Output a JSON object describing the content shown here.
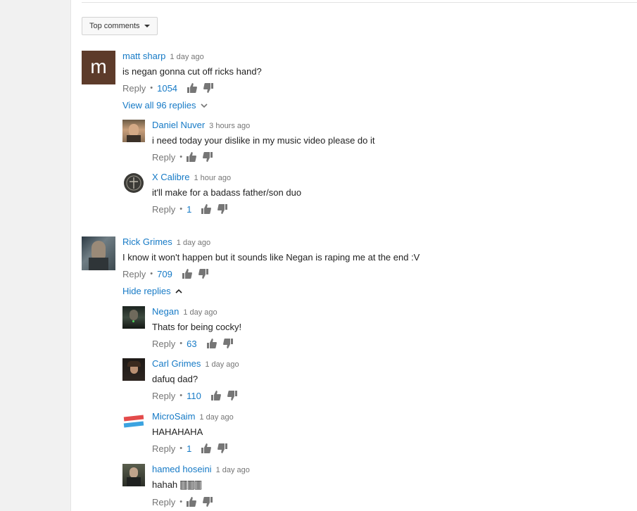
{
  "sort": {
    "label": "Top comments"
  },
  "threads": [
    {
      "author": "matt sharp",
      "time": "1 day ago",
      "text": "is negan gonna cut off ricks hand?",
      "reply_label": "Reply",
      "likes": "1054",
      "avatar_letter": "m",
      "toggle_label": "View all 96 replies",
      "replies": [
        {
          "author": "Daniel Nuver",
          "time": "3 hours ago",
          "text": "i need today your dislike in my music video please do it",
          "reply_label": "Reply",
          "likes": ""
        },
        {
          "author": "X Calibre",
          "time": "1 hour ago",
          "text": "it'll make for a badass father/son duo",
          "reply_label": "Reply",
          "likes": "1"
        }
      ]
    },
    {
      "author": "Rick Grimes",
      "time": "1 day ago",
      "text": "I know it won't happen but it sounds like Negan is raping me at the end :V",
      "reply_label": "Reply",
      "likes": "709",
      "toggle_label": "Hide replies",
      "replies": [
        {
          "author": "Negan",
          "time": "1 day ago",
          "text": "Thats for being cocky!",
          "reply_label": "Reply",
          "likes": "63"
        },
        {
          "author": "Carl Grimes",
          "time": "1 day ago",
          "text": "dafuq dad?",
          "reply_label": "Reply",
          "likes": "110"
        },
        {
          "author": "MicroSaim",
          "time": "1 day ago",
          "text": "HAHAHAHA",
          "reply_label": "Reply",
          "likes": "1"
        },
        {
          "author": "hamed hoseini",
          "time": "1 day ago",
          "text": "hahah 🀫🀫🀫",
          "reply_label": "Reply",
          "likes": ""
        }
      ]
    }
  ],
  "colors": {
    "link": "#167ac6",
    "meta": "#767676",
    "avatar_m_bg": "#5d3b2a"
  }
}
